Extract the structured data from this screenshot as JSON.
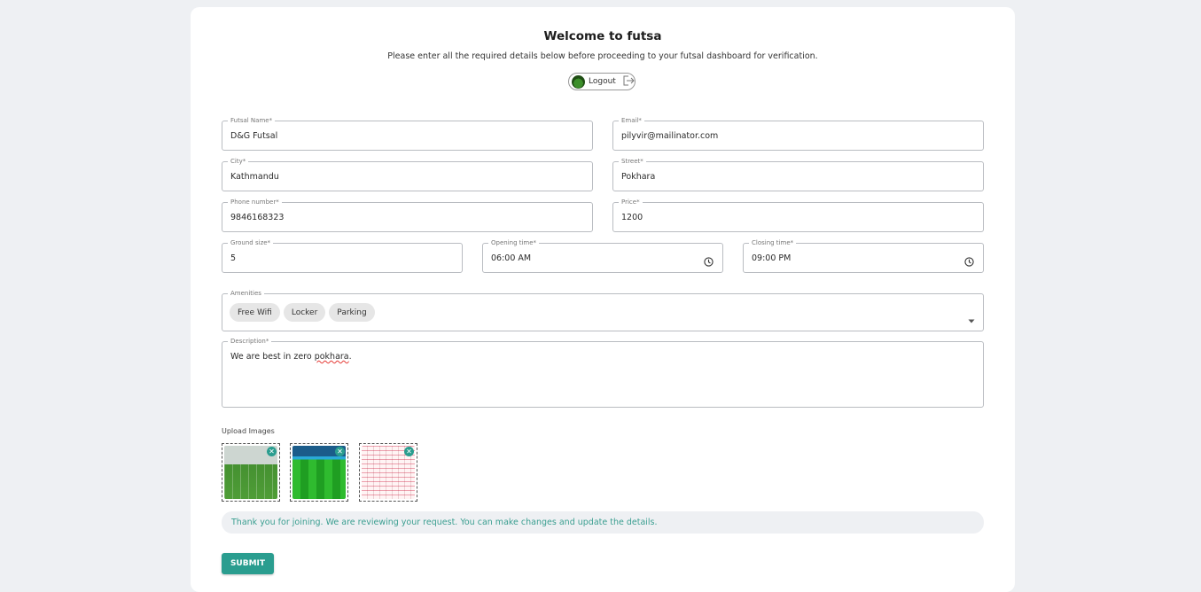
{
  "header": {
    "title": "Welcome to futsa",
    "subtitle": "Please enter all the required details below before proceeding to your futsal dashboard for verification.",
    "logout_label": "Logout"
  },
  "form": {
    "futsal_name": {
      "label": "Futsal Name*",
      "value": "D&G Futsal"
    },
    "email": {
      "label": "Email*",
      "value": "pilyvir@mailinator.com"
    },
    "city": {
      "label": "City*",
      "value": "Kathmandu"
    },
    "street": {
      "label": "Street*",
      "value": "Pokhara"
    },
    "phone": {
      "label": "Phone number*",
      "value": "9846168323"
    },
    "price": {
      "label": "Price*",
      "value": "1200"
    },
    "ground_size": {
      "label": "Ground size*",
      "value": "5"
    },
    "opening_time": {
      "label": "Opening time*",
      "value": "06:00 AM"
    },
    "closing_time": {
      "label": "Closing time*",
      "value": "09:00 PM"
    },
    "amenities": {
      "label": "Amenities",
      "chips": [
        "Free Wifi",
        "Locker",
        "Parking"
      ]
    },
    "description": {
      "label": "Description*",
      "value_start": "We are best in zero ",
      "value_typo": "pokhara",
      "value_end": "."
    }
  },
  "upload": {
    "label": "Upload Images",
    "images": [
      "futsal-field-photo",
      "futsal-field-photo",
      "document-scan"
    ]
  },
  "notice": "Thank you for joining. We are reviewing your request. You can make changes and update the details.",
  "submit_label": "SUBMIT",
  "colors": {
    "accent": "#2a9d8f",
    "background": "#eef0f3",
    "card": "#ffffff"
  }
}
